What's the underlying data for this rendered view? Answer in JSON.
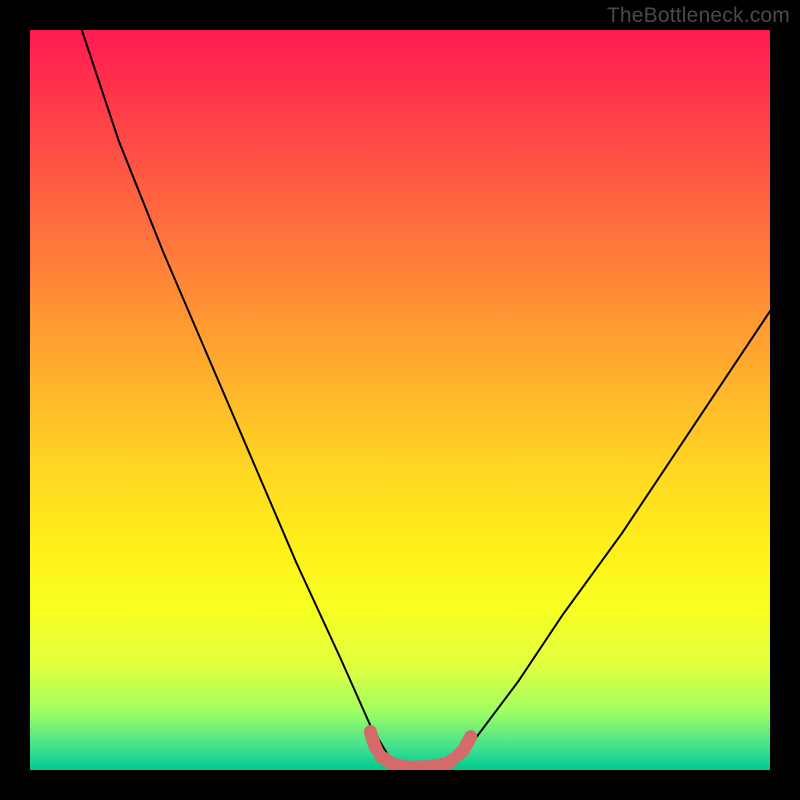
{
  "watermark": "TheBottleneck.com",
  "chart_data": {
    "type": "line",
    "title": "",
    "xlabel": "",
    "ylabel": "",
    "xlim": [
      0,
      100
    ],
    "ylim": [
      0,
      100
    ],
    "series": [
      {
        "name": "curve",
        "x": [
          7,
          12,
          18,
          24,
          30,
          36,
          42,
          46,
          49,
          51,
          53,
          56,
          60,
          66,
          72,
          80,
          90,
          100
        ],
        "y": [
          100,
          85,
          70,
          56,
          42,
          28,
          15,
          6,
          1,
          0,
          0,
          1,
          4,
          12,
          21,
          32,
          47,
          62
        ]
      }
    ],
    "markers": {
      "name": "highlight-segments",
      "color": "#d46a6a",
      "points": [
        {
          "x": 46.0,
          "y": 5.2
        },
        {
          "x": 46.5,
          "y": 3.5
        },
        {
          "x": 47.2,
          "y": 2.0
        },
        {
          "x": 49.0,
          "y": 0.8
        },
        {
          "x": 51.0,
          "y": 0.4
        },
        {
          "x": 53.0,
          "y": 0.4
        },
        {
          "x": 55.0,
          "y": 0.6
        },
        {
          "x": 56.5,
          "y": 0.9
        },
        {
          "x": 58.5,
          "y": 2.6
        },
        {
          "x": 59.2,
          "y": 3.8
        },
        {
          "x": 59.8,
          "y": 5.0
        }
      ]
    }
  }
}
